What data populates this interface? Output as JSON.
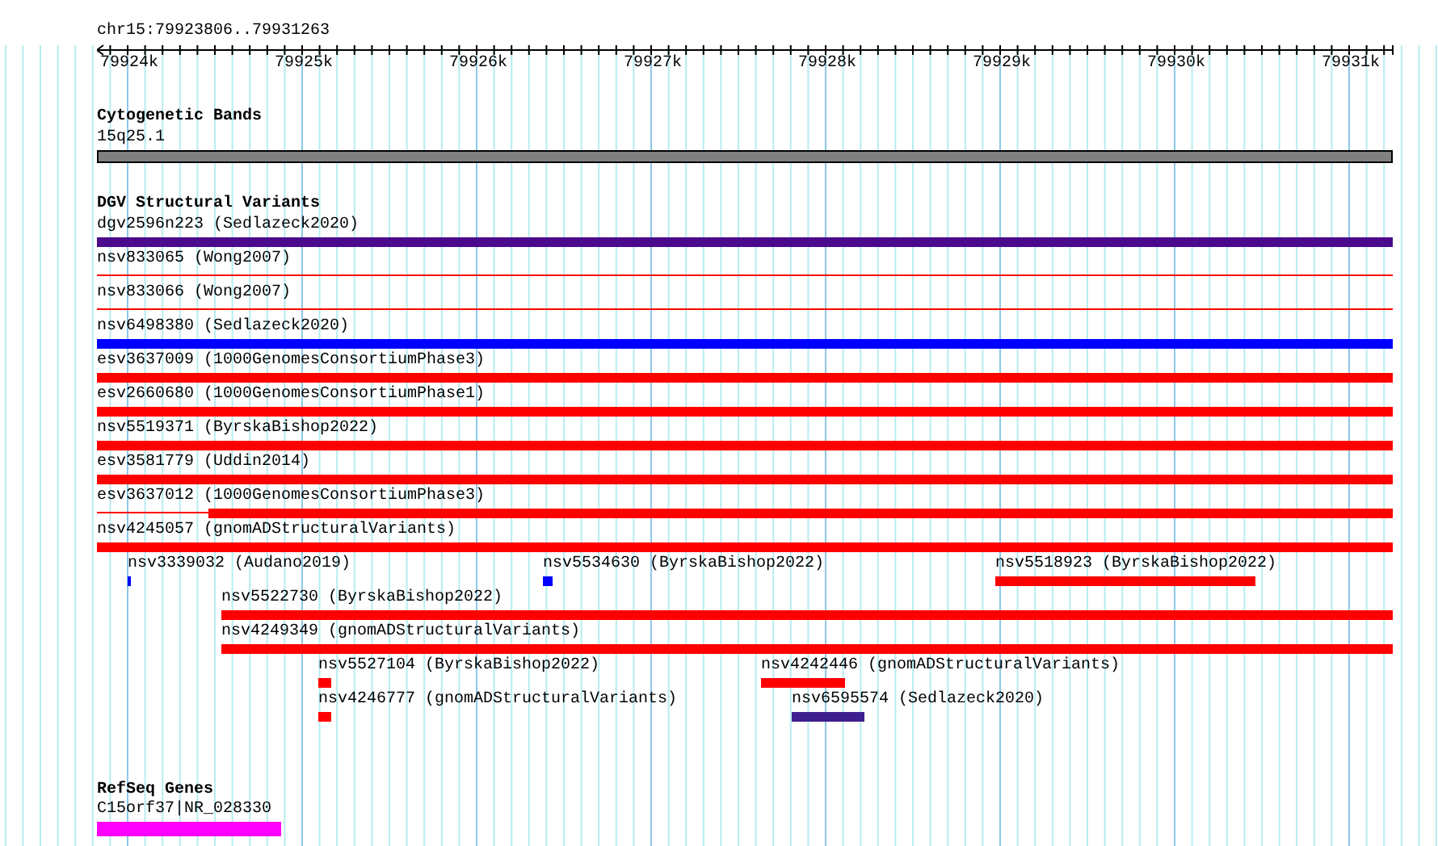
{
  "ruler": {
    "location": "chr15:79923806..79931263",
    "ticks": [
      "79924k",
      "79925k",
      "79926k",
      "79927k",
      "79928k",
      "79929k",
      "79930k",
      "79931k"
    ]
  },
  "tracks": [
    {
      "kind": "bands",
      "title": "Cytogenetic Bands",
      "features": [
        {
          "label": "15q25.1",
          "color": "#808080",
          "kind": "bar"
        }
      ]
    },
    {
      "kind": "variants",
      "title": "DGV Structural Variants",
      "features": [
        {
          "label": "dgv2596n223 (Sedlazeck2020)",
          "color": "#4b0a8c",
          "kind": "bar"
        },
        {
          "label": "nsv833065 (Wong2007)",
          "color": "#ff0000",
          "kind": "line"
        },
        {
          "label": "nsv833066 (Wong2007)",
          "color": "#ff0000",
          "kind": "line"
        },
        {
          "label": "nsv6498380 (Sedlazeck2020)",
          "color": "#0000ff",
          "kind": "bar"
        },
        {
          "label": "esv3637009 (1000GenomesConsortiumPhase3)",
          "color": "#ff0000",
          "kind": "bar"
        },
        {
          "label": "esv2660680 (1000GenomesConsortiumPhase1)",
          "color": "#ff0000",
          "kind": "bar"
        },
        {
          "label": "nsv5519371 (ByrskaBishop2022)",
          "color": "#ff0000",
          "kind": "bar"
        },
        {
          "label": "esv3581779 (Uddin2014)",
          "color": "#ff0000",
          "kind": "bar"
        },
        {
          "label": "esv3637012 (1000GenomesConsortiumPhase3)",
          "color": "#ff0000",
          "kind": "partial"
        },
        {
          "label": "nsv4245057 (gnomADStructuralVariants)",
          "color": "#ff0000",
          "kind": "bar"
        },
        {
          "label": "nsv3339032 (Audano2019)",
          "color": "#0000ff",
          "kind": "bar"
        },
        {
          "label": "nsv5534630 (ByrskaBishop2022)",
          "color": "#0000ff",
          "kind": "bar"
        },
        {
          "label": "nsv5518923 (ByrskaBishop2022)",
          "color": "#ff0000",
          "kind": "bar"
        },
        {
          "label": "nsv5522730 (ByrskaBishop2022)",
          "color": "#ff0000",
          "kind": "bar"
        },
        {
          "label": "nsv4249349 (gnomADStructuralVariants)",
          "color": "#ff0000",
          "kind": "bar"
        },
        {
          "label": "nsv5527104 (ByrskaBishop2022)",
          "color": "#ff0000",
          "kind": "bar"
        },
        {
          "label": "nsv4242446 (gnomADStructuralVariants)",
          "color": "#ff0000",
          "kind": "bar"
        },
        {
          "label": "nsv4246777 (gnomADStructuralVariants)",
          "color": "#ff0000",
          "kind": "bar"
        },
        {
          "label": "nsv6595574 (Sedlazeck2020)",
          "color": "#3f1f8f",
          "kind": "bar"
        }
      ]
    },
    {
      "kind": "genes",
      "title": "RefSeq Genes",
      "features": [
        {
          "label": "C15orf37|NR_028330",
          "color": "#ff00ff",
          "kind": "bar"
        }
      ]
    }
  ]
}
